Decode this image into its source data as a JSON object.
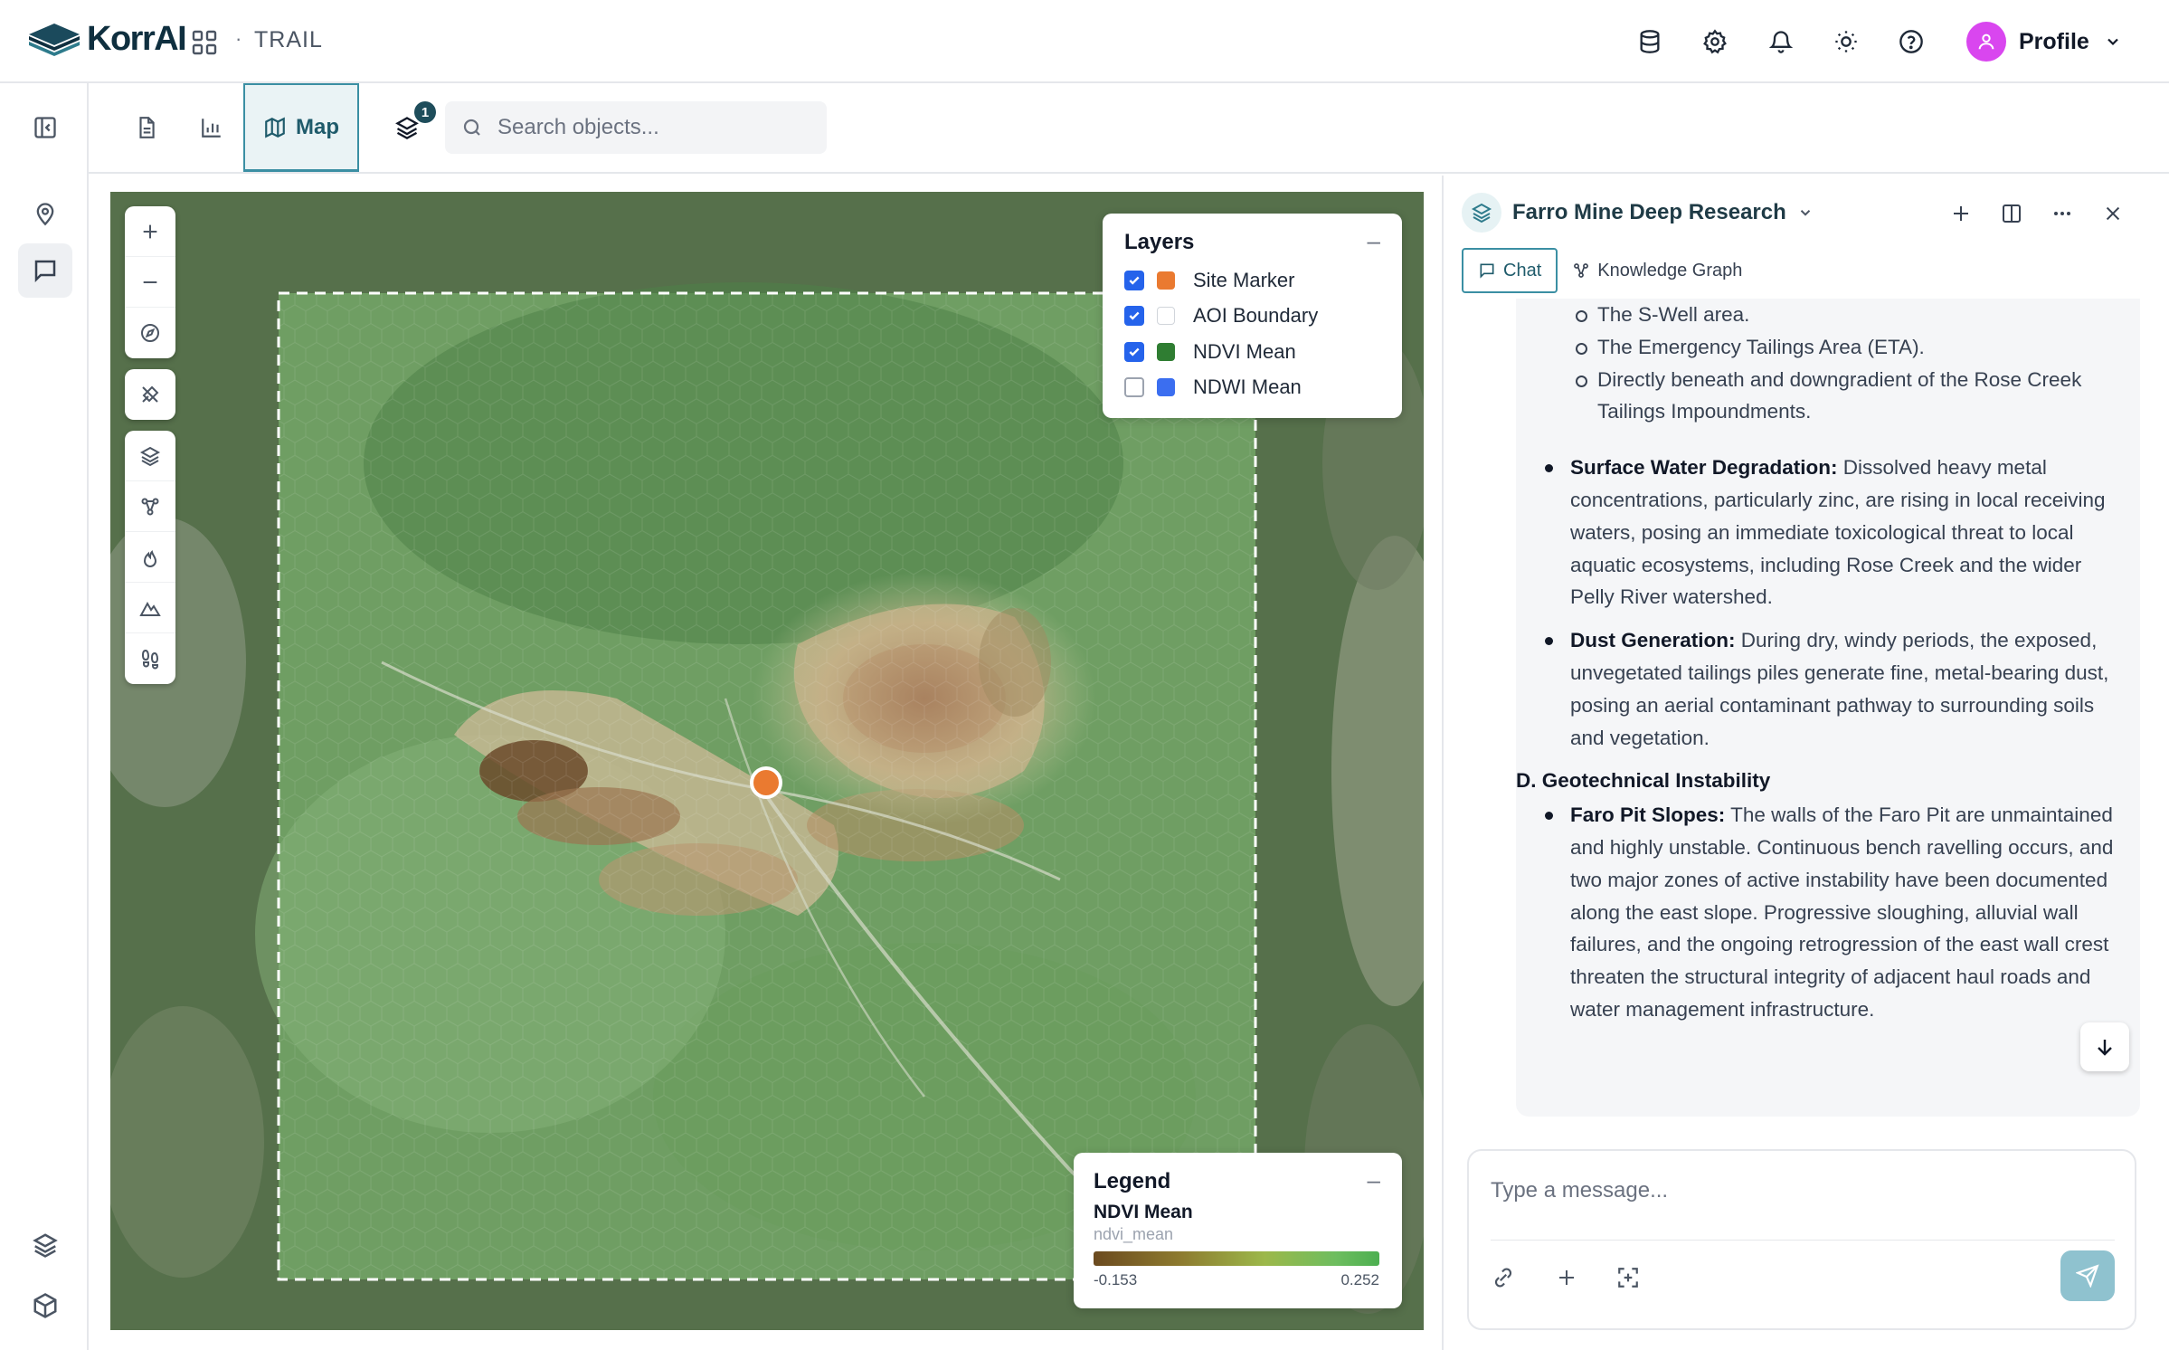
{
  "app": {
    "brand": "KorrAI",
    "breadcrumb_sep": "·",
    "breadcrumb": "TRAIL",
    "profile_label": "Profile",
    "accent": "#3b8fa3",
    "brand_color": "#0f2f3f",
    "avatar_color": "#d946ef"
  },
  "topbar_icons": [
    "database-icon",
    "settings-icon",
    "bell-icon",
    "sun-icon",
    "help-icon"
  ],
  "toolbar": {
    "tabs": [
      {
        "icon": "document-icon",
        "label": ""
      },
      {
        "icon": "bar-chart-icon",
        "label": ""
      },
      {
        "icon": "map-icon",
        "label": "Map",
        "active": true
      },
      {
        "icon": "layers-icon",
        "label": ""
      }
    ],
    "layers_badge": "1",
    "search_placeholder": "Search objects..."
  },
  "left_rail": [
    "collapse-panel-icon",
    "location-pin-icon",
    "chat-icon",
    "layers-icon",
    "cube-icon"
  ],
  "map": {
    "tools": [
      "zoom-in-icon",
      "zoom-out-icon",
      "compass-icon",
      "draw-icon",
      "layers-icon",
      "graph-icon",
      "fire-icon",
      "terrain-icon",
      "footprints-icon"
    ],
    "layers_panel": {
      "title": "Layers",
      "items": [
        {
          "label": "Site Marker",
          "checked": true,
          "color": "#ea7a30"
        },
        {
          "label": "AOI Boundary",
          "checked": true,
          "color": "#ffffff"
        },
        {
          "label": "NDVI Mean",
          "checked": true,
          "color": "#2f7d32"
        },
        {
          "label": "NDWI Mean",
          "checked": false,
          "color": "#3b6ef0"
        }
      ]
    },
    "legend": {
      "title": "Legend",
      "layer": "NDVI Mean",
      "field": "ndvi_mean",
      "min": "-0.153",
      "max": "0.252"
    },
    "site_marker_color": "#ea7a30"
  },
  "chat": {
    "title": "Farro Mine Deep Research",
    "tabs": [
      {
        "label": "Chat",
        "active": true
      },
      {
        "label": "Knowledge Graph",
        "active": false
      }
    ],
    "sub_bullets": [
      "The S-Well area.",
      "The Emergency Tailings Area (ETA).",
      "Directly beneath and downgradient of the Rose Creek Tailings Impoundments."
    ],
    "bullets": [
      {
        "head": "Surface Water Degradation:",
        "text": " Dissolved heavy metal concentrations, particularly zinc, are rising in local receiving waters, posing an immediate toxicological threat to local aquatic ecosystems, including Rose Creek and the wider Pelly River watershed."
      },
      {
        "head": "Dust Generation:",
        "text": " During dry, windy periods, the exposed, unvegetated tailings piles generate fine, metal-bearing dust, posing an aerial contaminant pathway to surrounding soils and vegetation."
      }
    ],
    "section_heading": "D. Geotechnical Instability",
    "section_bullets": [
      {
        "head": "Faro Pit Slopes:",
        "text": " The walls of the Faro Pit are unmaintained and highly unstable. Continuous bench ravelling occurs, and two major zones of active instability have been documented along the east slope. Progressive sloughing, alluvial wall failures, and the ongoing retrogression of the east wall crest threaten the structural integrity of adjacent haul roads and water management infrastructure."
      }
    ],
    "composer_placeholder": "Type a message..."
  }
}
